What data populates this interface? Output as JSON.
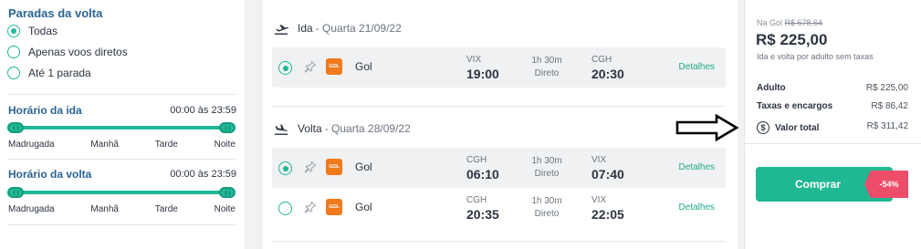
{
  "filters": {
    "stops_title": "Paradas da volta",
    "stops_options": [
      {
        "label": "Todas",
        "selected": true
      },
      {
        "label": "Apenas voos diretos",
        "selected": false
      },
      {
        "label": "Até 1 parada",
        "selected": false
      }
    ],
    "outbound_time": {
      "title": "Horário da ida",
      "value": "00:00 às 23:59",
      "ticks": [
        "Madrugada",
        "Manhã",
        "Tarde",
        "Noite"
      ]
    },
    "return_time": {
      "title": "Horário da volta",
      "value": "00:00 às 23:59",
      "ticks": [
        "Madrugada",
        "Manhã",
        "Tarde",
        "Noite"
      ]
    }
  },
  "outbound": {
    "label": "Ida",
    "date": "- Quarta 21/09/22",
    "flights": [
      {
        "selected": true,
        "logo": "GOL",
        "airline": "Gol",
        "from": "VIX",
        "dep": "19:00",
        "duration": "1h 30m",
        "stops": "Direto",
        "to": "CGH",
        "arr": "20:30",
        "details": "Detalhes"
      }
    ]
  },
  "return": {
    "label": "Volta",
    "date": "- Quarta 28/09/22",
    "flights": [
      {
        "selected": true,
        "logo": "GOL",
        "airline": "Gol",
        "from": "CGH",
        "dep": "06:10",
        "duration": "1h 30m",
        "stops": "Direto",
        "to": "VIX",
        "arr": "07:40",
        "details": "Detalhes"
      },
      {
        "selected": false,
        "logo": "GOL",
        "airline": "Gol",
        "from": "CGH",
        "dep": "20:35",
        "duration": "1h 30m",
        "stops": "Direto",
        "to": "VIX",
        "arr": "22:05",
        "details": "Detalhes"
      }
    ]
  },
  "price": {
    "old_label": "Na Gol",
    "old_price": "R$ 678,64",
    "price": "R$ 225,00",
    "note": "Ida e volta por adulto sem taxas",
    "adult_label": "Adulto",
    "adult_value": "R$ 225,00",
    "fees_label": "Taxas e encargos",
    "fees_value": "R$ 86,42",
    "total_label": "Valor total",
    "total_value": "R$ 311,42",
    "buy_label": "Comprar",
    "discount": "-54%"
  },
  "icons": {
    "dollar": "$"
  },
  "colors": {
    "accent": "#20b893",
    "heading": "#2a6496",
    "discount": "#ee4d6a",
    "airline_logo": "#f07a1c"
  }
}
